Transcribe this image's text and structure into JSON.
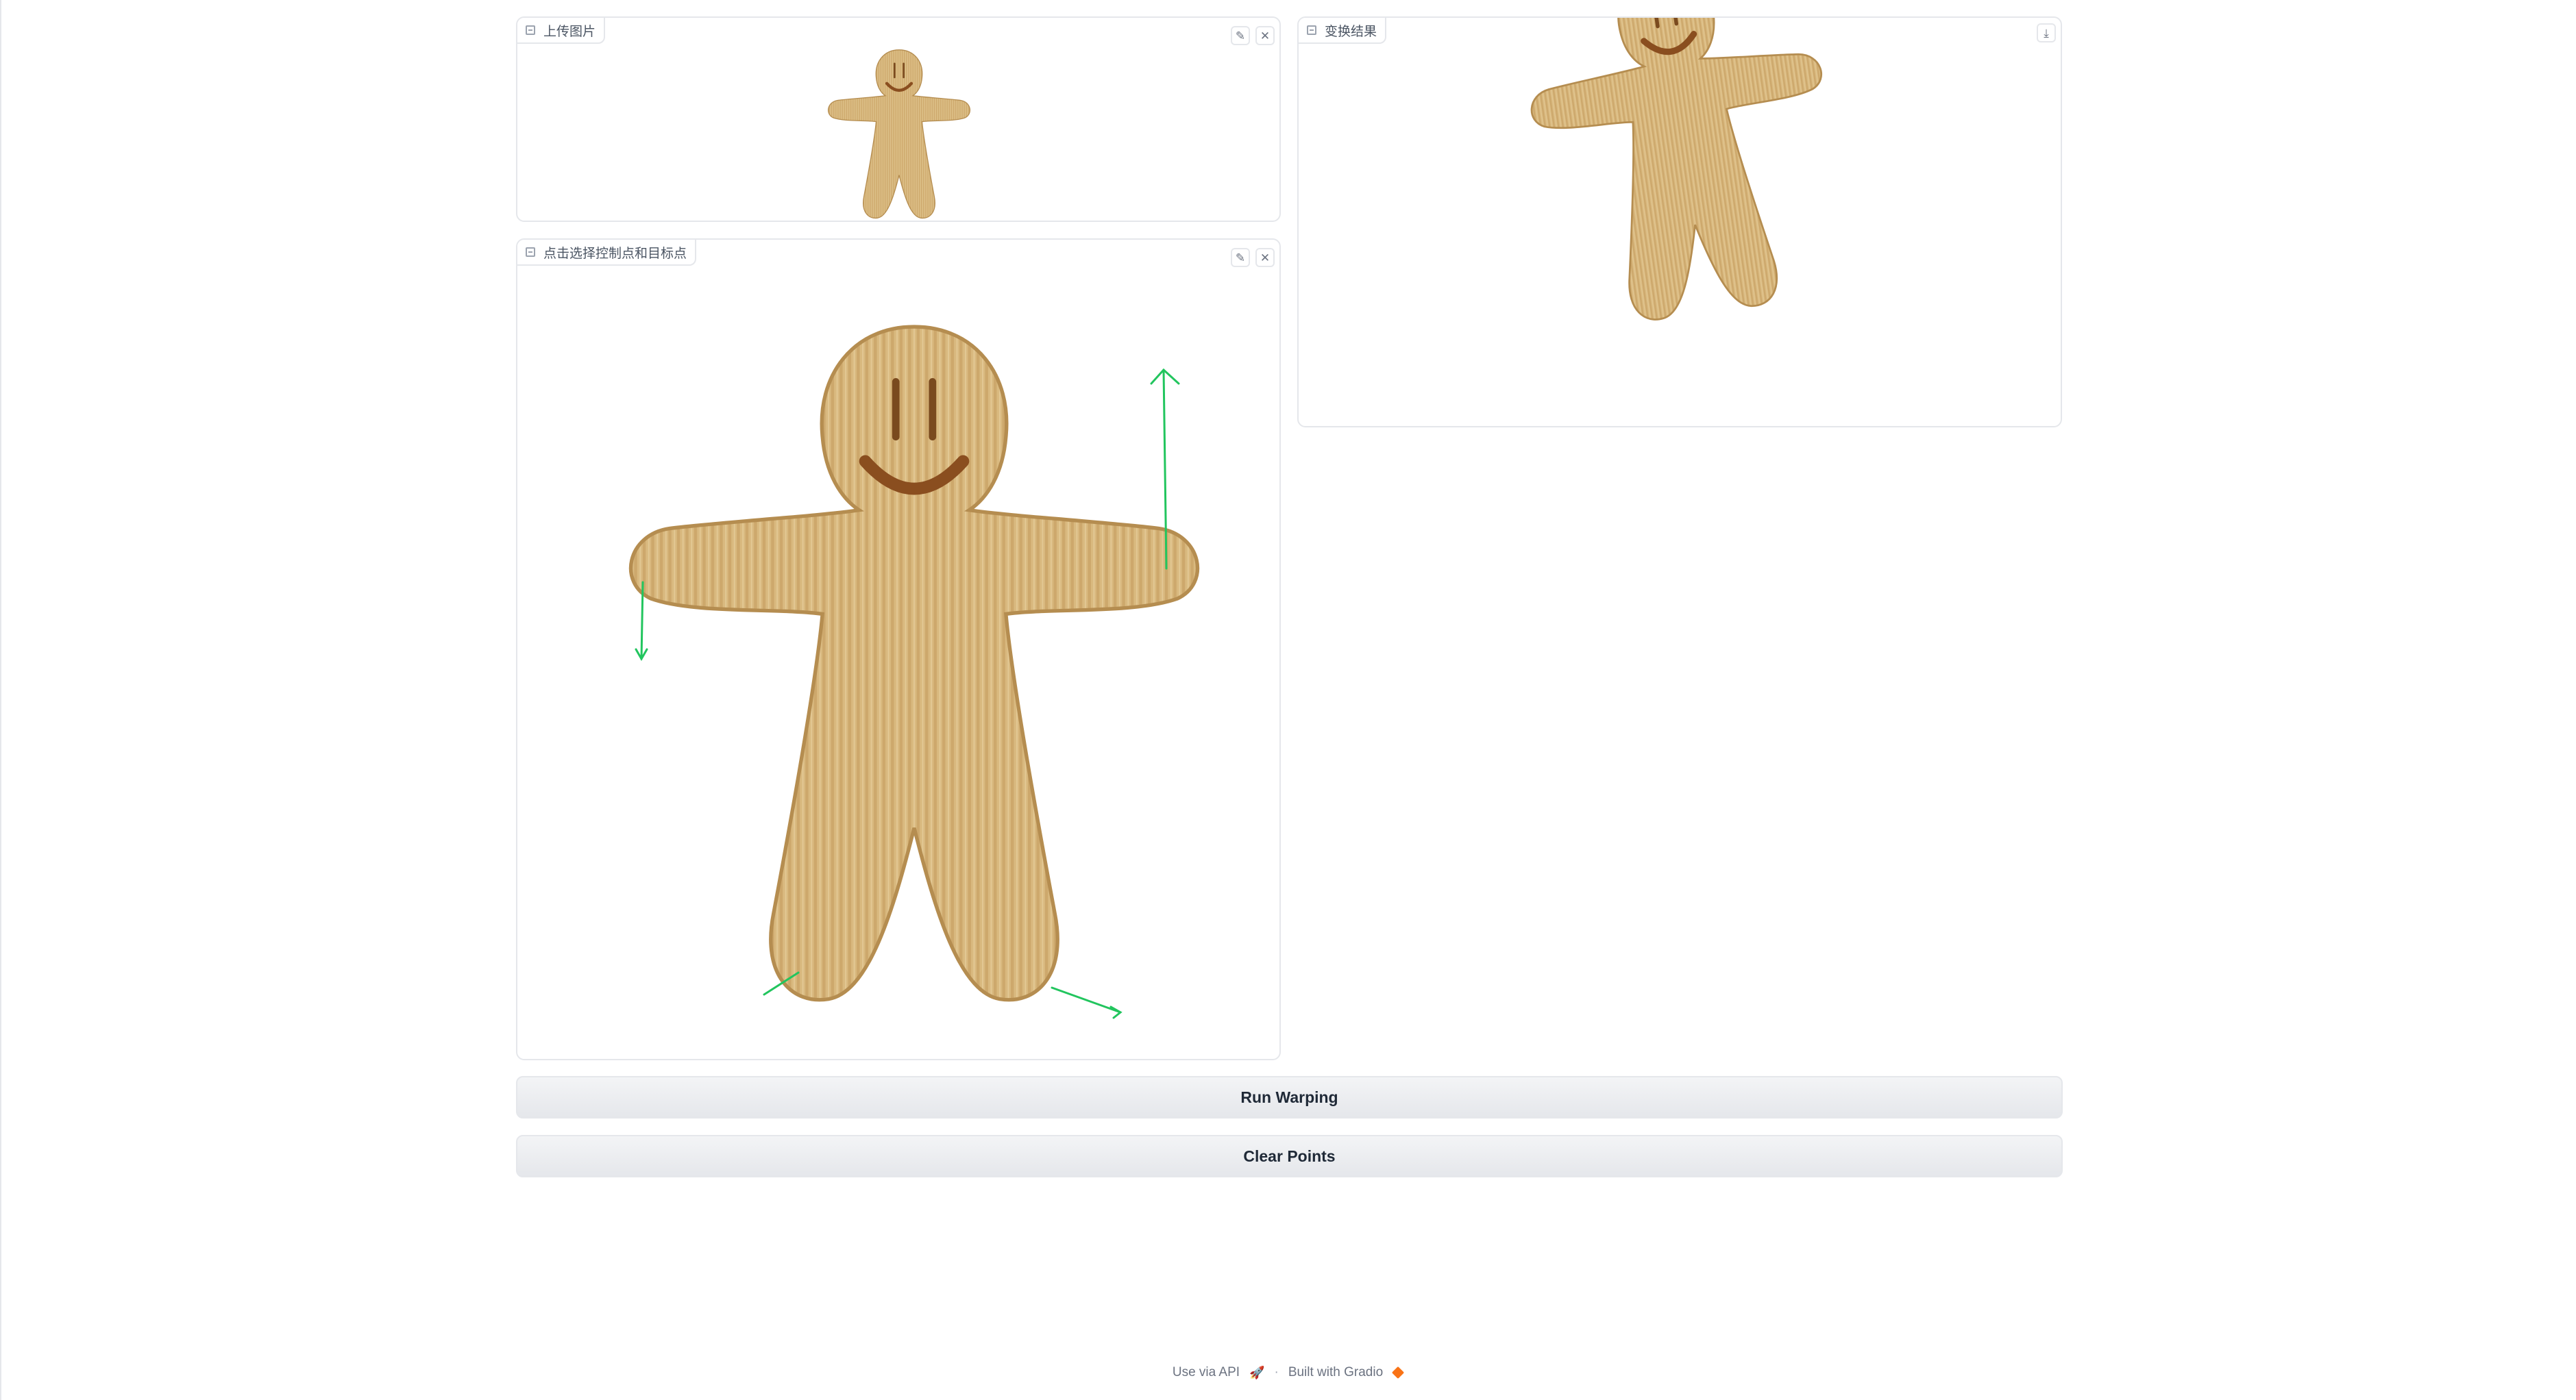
{
  "panels": {
    "upload": {
      "label": "上传图片"
    },
    "points": {
      "label": "点击选择控制点和目标点"
    },
    "result": {
      "label": "变换结果"
    }
  },
  "buttons": {
    "run": "Run Warping",
    "clear": "Clear Points"
  },
  "footer": {
    "api": "Use via API",
    "separator": "·",
    "built": "Built with Gradio"
  },
  "icons": {
    "edit": "pencil-icon",
    "clear": "close-icon",
    "download": "download-icon",
    "image": "image-icon",
    "rocket": "rocket-icon",
    "gradio": "gradio-logo-icon"
  },
  "colors": {
    "wood": "#d7b57b",
    "wood_dark": "#b58d50",
    "mouth": "#9a5a25",
    "arrow": "#22c55e"
  }
}
